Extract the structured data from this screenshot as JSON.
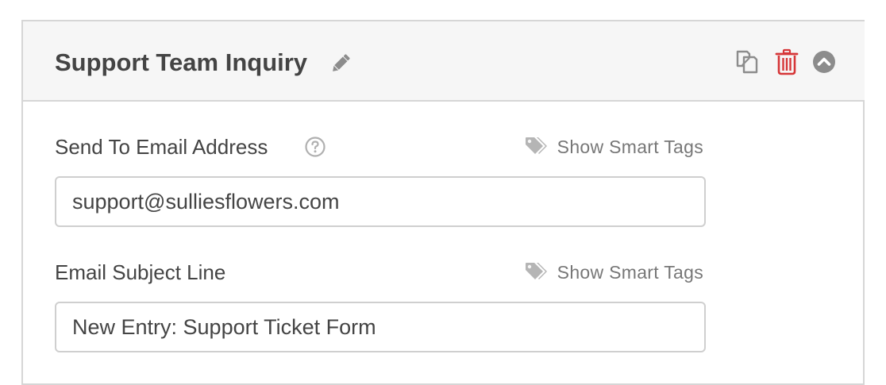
{
  "notification": {
    "title": "Support Team Inquiry",
    "actions": {
      "edit_icon": "pencil-icon",
      "duplicate_icon": "duplicate-icon",
      "delete_icon": "trash-icon",
      "collapse_icon": "chevron-up-circle-icon"
    }
  },
  "fields": {
    "send_to": {
      "label": "Send To Email Address",
      "help_icon": "question-circle-icon",
      "smart_tags_label": "Show Smart Tags",
      "value": "support@sulliesflowers.com"
    },
    "subject": {
      "label": "Email Subject Line",
      "smart_tags_label": "Show Smart Tags",
      "value": "New Entry: Support Ticket Form"
    }
  },
  "colors": {
    "header_bg": "#f6f6f6",
    "border": "#d6d6d6",
    "text": "#444444",
    "muted": "#777777",
    "danger": "#d63638",
    "icon_gray": "#8c8c8c"
  }
}
